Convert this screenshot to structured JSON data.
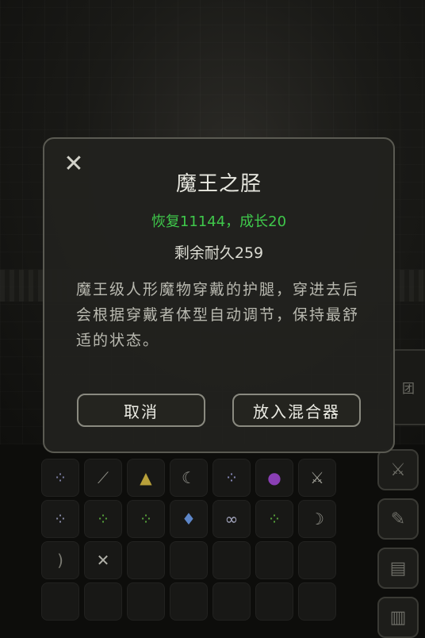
{
  "dialog": {
    "title": "魔王之胫",
    "effect": "恢复11144，成长20",
    "durability": "剩余耐久259",
    "description": "魔王级人形魔物穿戴的护腿，穿进去后会根据穿戴者体型自动调节，保持最舒适的状态。",
    "cancel_label": "取消",
    "mix_label": "放入混合器",
    "close_icon": "close-icon",
    "colors": {
      "effect_text": "#3fc84b",
      "border": "#5a5a52",
      "panel": "#21211e"
    }
  },
  "side_panel": {
    "tab_label": "团",
    "buttons": [
      "sword-icon",
      "scroll-icon",
      "map-icon",
      "book-icon"
    ]
  },
  "inventory": {
    "rows": [
      [
        "orb-cluster-icon",
        "skewer-icon",
        "pyramid-icon",
        "sickle-icon",
        "orb-cluster-icon",
        "purple-orb-icon",
        "sword-icon"
      ],
      [
        "orb-cluster-icon",
        "green-berry-icon",
        "green-berry-icon",
        "crystal-icon",
        "chain-icon",
        "green-berry-icon",
        "claw-icon"
      ],
      [
        "bow-icon",
        "bone-icon",
        "",
        "",
        "",
        "",
        ""
      ],
      [
        "",
        "",
        "",
        "",
        "",
        "",
        ""
      ]
    ]
  }
}
